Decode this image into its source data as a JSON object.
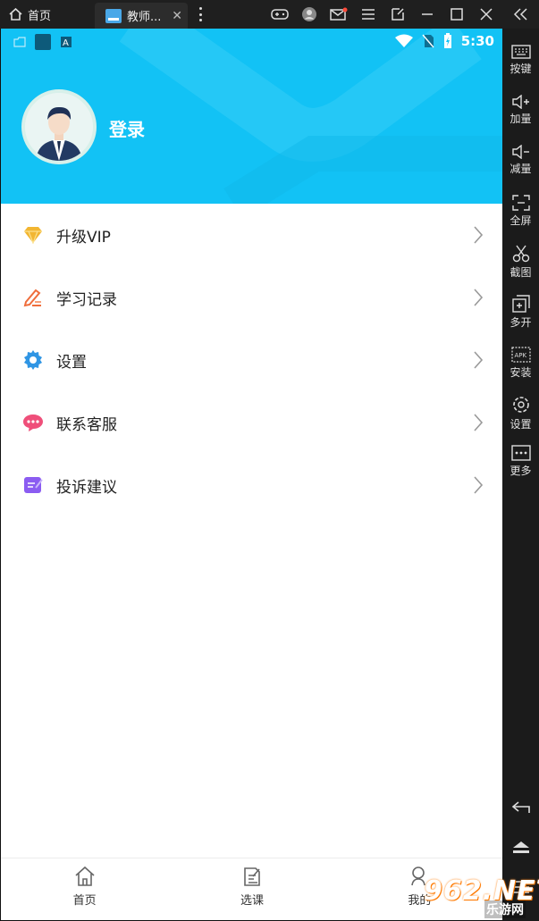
{
  "titlebar": {
    "home_label": "首页",
    "tab_label": "教师...",
    "icons": [
      "gamepad-icon",
      "user-icon",
      "mail-icon",
      "menu-icon",
      "window-shrink-icon",
      "minimize-icon",
      "maximize-icon",
      "close-icon"
    ]
  },
  "statusbar": {
    "time": "5:30"
  },
  "profile": {
    "login_label": "登录"
  },
  "menu": {
    "items": [
      {
        "label": "升级VIP",
        "icon": "vip-diamond-icon",
        "color": "#f2b632"
      },
      {
        "label": "学习记录",
        "icon": "pen-record-icon",
        "color": "#ef6d3c"
      },
      {
        "label": "设置",
        "icon": "gear-icon",
        "color": "#2f95e4"
      },
      {
        "label": "联系客服",
        "icon": "chat-bubble-icon",
        "color": "#ef4f7a"
      },
      {
        "label": "投诉建议",
        "icon": "feedback-icon",
        "color": "#8b5cf1"
      }
    ]
  },
  "bottomnav": {
    "items": [
      {
        "label": "首页",
        "icon": "home-icon"
      },
      {
        "label": "选课",
        "icon": "course-icon"
      },
      {
        "label": "我的",
        "icon": "profile-icon"
      }
    ]
  },
  "sidebar": {
    "items": [
      {
        "label": "按键",
        "icon": "keyboard-icon"
      },
      {
        "label": "加量",
        "icon": "volume-up-icon"
      },
      {
        "label": "减量",
        "icon": "volume-down-icon"
      },
      {
        "label": "全屏",
        "icon": "fullscreen-icon"
      },
      {
        "label": "截图",
        "icon": "scissors-icon"
      },
      {
        "label": "多开",
        "icon": "multi-instance-icon"
      },
      {
        "label": "安装",
        "icon": "apk-install-icon"
      },
      {
        "label": "设置",
        "icon": "settings-icon"
      },
      {
        "label": "更多",
        "icon": "more-icon"
      }
    ]
  },
  "watermark": {
    "top": "962.NET",
    "bottom": "乐游网"
  },
  "colors": {
    "header": "#12c2f5",
    "accent_vip": "#f2b632"
  }
}
